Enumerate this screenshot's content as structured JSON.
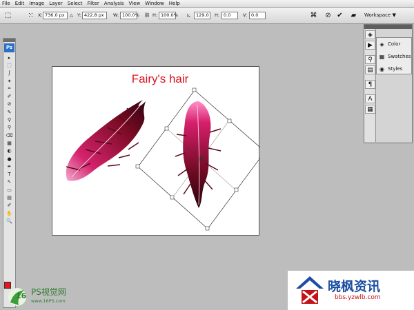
{
  "menu": [
    "File",
    "Edit",
    "Image",
    "Layer",
    "Select",
    "Filter",
    "Analysis",
    "View",
    "Window",
    "Help"
  ],
  "options": {
    "x_label": "X:",
    "x_value": "736.0 px",
    "y_label": "Y:",
    "y_value": "422.8 px",
    "w_label": "W:",
    "w_value": "100.0%",
    "h_label": "H:",
    "h_value": "100.0%",
    "angle_value": "129.0",
    "hskew_label": "H:",
    "hskew_value": "0.0",
    "vskew_label": "V:",
    "vskew_value": "0.0",
    "workspace_label": "Workspace ▼"
  },
  "tools": {
    "logo": "Ps",
    "icons": [
      "▸",
      "⬚",
      "ʃ",
      "✦",
      "⌗",
      "✐",
      "⊘",
      "✎",
      "⚲",
      "⚲",
      "⌫",
      "▦",
      "◐",
      "●",
      "✒",
      "T",
      "↖",
      "▭",
      "▤",
      "✐",
      "✋",
      "🔍"
    ],
    "fg_color": "#e8141e",
    "bg_color": "#ffffff"
  },
  "canvas": {
    "title": "Fairy's hair"
  },
  "panels": {
    "items": [
      {
        "icon": "◈",
        "label": "Color"
      },
      {
        "icon": "▦",
        "label": "Swatches"
      },
      {
        "icon": "◉",
        "label": "Styles"
      }
    ]
  },
  "watermark_left": {
    "text": "PS视觉网",
    "url": "www.16PS.com",
    "logo_text": "16"
  },
  "watermark_right": {
    "title": "晓枫资讯",
    "url": "bbs.yzwlb.com"
  }
}
